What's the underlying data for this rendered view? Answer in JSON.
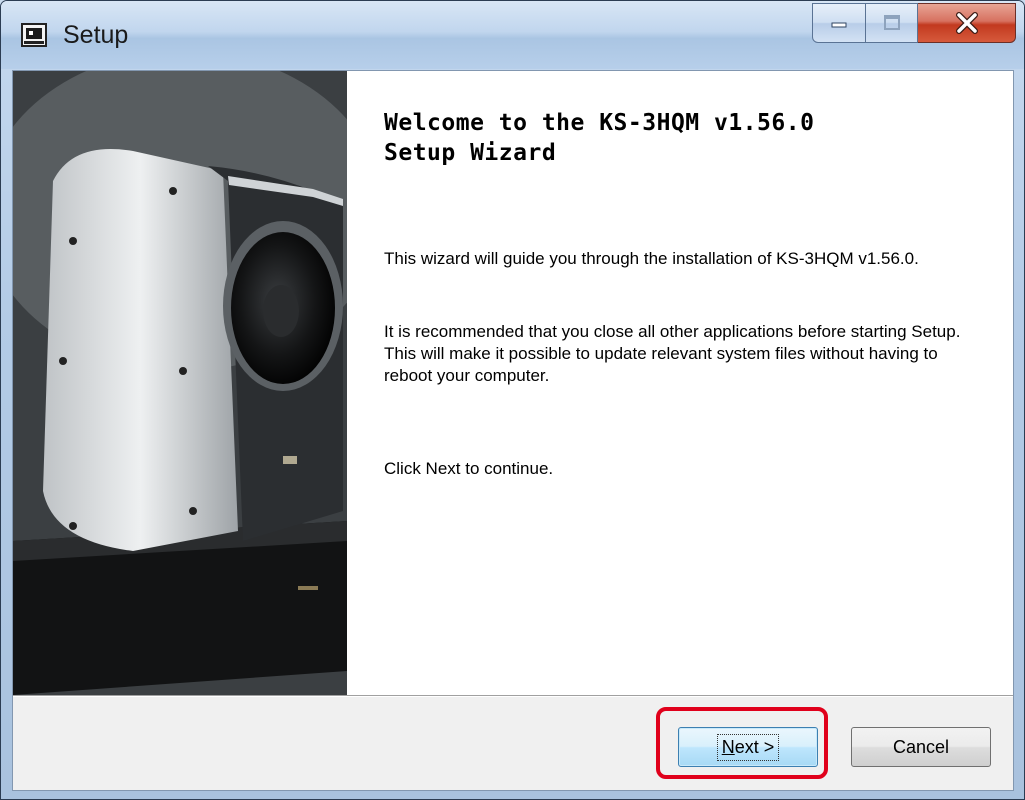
{
  "window": {
    "title": "Setup"
  },
  "welcome": {
    "heading_line1": "Welcome to the KS-3HQM v1.56.0",
    "heading_line2": "Setup Wizard",
    "para1": "This wizard will guide you through the installation of KS-3HQM v1.56.0.",
    "para2": "It is recommended that you close all other applications before starting Setup. This will make it possible to update relevant system files without having to reboot your computer.",
    "para3": "Click Next to continue."
  },
  "buttons": {
    "next_label_mnemonic": "N",
    "next_label_rest": "ext >",
    "cancel_label": "Cancel"
  },
  "colors": {
    "highlight": "#e0001b",
    "close_button": "#c2391f"
  },
  "icons": {
    "window": "setup-app-icon",
    "minimize": "minimize-icon",
    "maximize": "maximize-icon",
    "close": "close-icon"
  }
}
